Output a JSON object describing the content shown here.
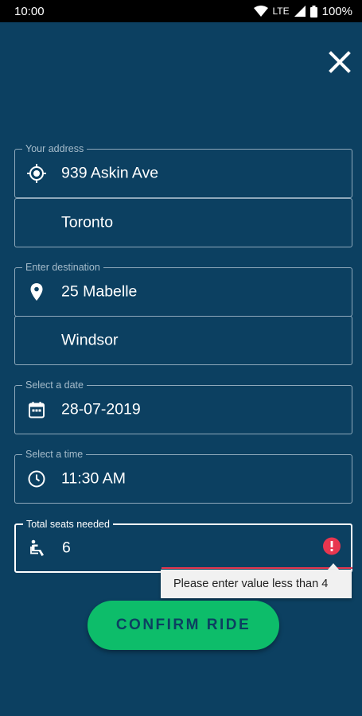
{
  "status_bar": {
    "time": "10:00",
    "network": "LTE",
    "battery": "100%"
  },
  "colors": {
    "background": "#0c4061",
    "accent": "#0dbd6a",
    "error": "#e8364f"
  },
  "form": {
    "address": {
      "label": "Your address",
      "street": "939 Askin Ave",
      "city": "Toronto"
    },
    "destination": {
      "label": "Enter destination",
      "street": "25 Mabelle",
      "city": "Windsor"
    },
    "date": {
      "label": "Select a date",
      "value": "28-07-2019"
    },
    "time": {
      "label": "Select a time",
      "value": "11:30 AM"
    },
    "seats": {
      "label": "Total seats needed",
      "value": "6",
      "error": "Please enter value less than 4"
    }
  },
  "actions": {
    "confirm_label": "CONFIRM RIDE"
  },
  "icons": {
    "close": "close-icon",
    "address": "my-location-icon",
    "destination": "location-pin-icon",
    "date": "calendar-icon",
    "time": "clock-icon",
    "seats": "seat-icon",
    "error": "error-icon"
  }
}
